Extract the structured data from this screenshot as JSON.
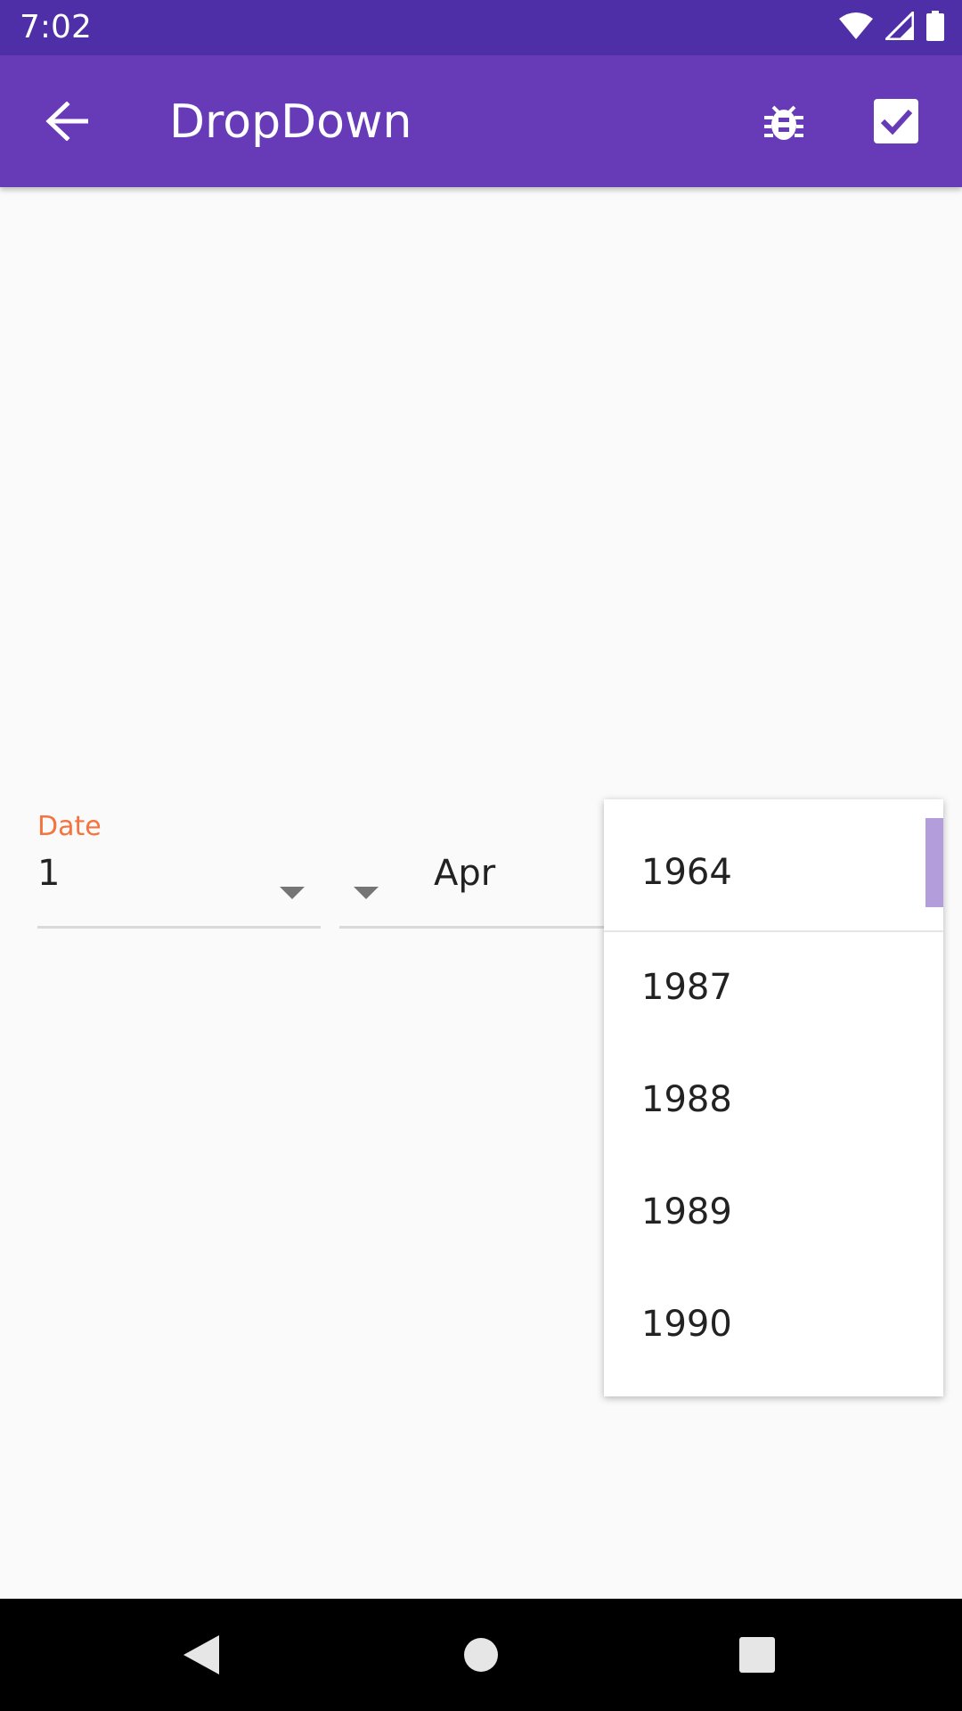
{
  "status_bar": {
    "time": "7:02",
    "icons": [
      "wifi-icon",
      "signal-icon",
      "battery-icon"
    ]
  },
  "app_bar": {
    "title": "DropDown",
    "actions": [
      "back-arrow-icon",
      "bug-icon",
      "checkbox-checked-icon"
    ]
  },
  "form": {
    "label": "Date",
    "day": "1",
    "month": "Apr"
  },
  "year_menu": {
    "items": [
      "1964",
      "1987",
      "1988",
      "1989",
      "1990"
    ]
  },
  "colors": {
    "status_bar": "#4f2fa8",
    "app_bar": "#673ab7",
    "label_accent": "#f4733f",
    "scroll_thumb": "#b39ddb"
  },
  "nav_bar": {
    "buttons": [
      "back-triangle-icon",
      "home-circle-icon",
      "recents-square-icon"
    ]
  }
}
